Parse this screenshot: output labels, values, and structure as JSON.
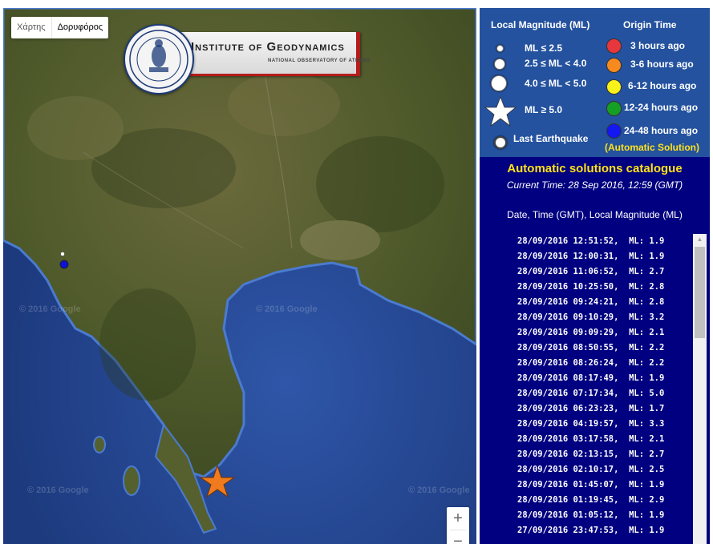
{
  "map": {
    "map_type_buttons": [
      {
        "label": "Χάρτης",
        "active": false
      },
      {
        "label": "Δορυφόρος",
        "active": true
      }
    ],
    "logo": {
      "title": "Institute of Geodynamics",
      "subtitle": "NATIONAL OBSERVATORY OF ATHENS"
    },
    "watermarks": [
      "© 2016 Google",
      "© 2016 Google",
      "© 2016 Google",
      "© 2016 Google"
    ],
    "zoom_in": "+",
    "zoom_out": "−",
    "markers": [
      {
        "type": "last-earthquake",
        "shape": "star",
        "color": "#f07a1e",
        "magnitude": "ML: 5.0",
        "time": "28/09/2016 07:17:34"
      },
      {
        "type": "earthquake",
        "shape": "circle",
        "color": "#0b12d6",
        "age": "24-48 hours ago"
      },
      {
        "type": "earthquake",
        "shape": "circle",
        "color": "#ffffff",
        "age": "small"
      }
    ],
    "colors": {
      "sea": "#1f3f86",
      "deep_sea": "#2a4fa0",
      "land": "#55602f",
      "coast": "#3e6ec0"
    }
  },
  "legend": {
    "magnitude_header": "Local Magnitude (ML)",
    "origin_header": "Origin Time",
    "magnitude_items": [
      {
        "label": "ML ≤ 2.5",
        "icon": "small-circle-icon"
      },
      {
        "label": "2.5 ≤ ML < 4.0",
        "icon": "medium-circle-icon"
      },
      {
        "label": "4.0 ≤ ML < 5.0",
        "icon": "large-circle-icon"
      },
      {
        "label": "ML ≥ 5.0",
        "icon": "star-icon"
      },
      {
        "label": "Last Earthquake",
        "icon": "ring-icon"
      }
    ],
    "origin_items": [
      {
        "label": "3 hours ago",
        "color": "#e8373c"
      },
      {
        "label": "3-6 hours ago",
        "color": "#f68a1f"
      },
      {
        "label": "6-12 hours ago",
        "color": "#f9f21a"
      },
      {
        "label": "12-24 hours ago",
        "color": "#159f24"
      },
      {
        "label": "24-48 hours ago",
        "color": "#1318f0"
      }
    ],
    "automatic_note": "(Automatic Solution)"
  },
  "catalog": {
    "title": "Automatic solutions catalogue",
    "current_time": "Current Time: 28 Sep 2016, 12:59 (GMT)",
    "columns": "Date, Time (GMT), Local Magnitude (ML)",
    "entries": [
      "28/09/2016 12:51:52,  ML: 1.9",
      "28/09/2016 12:00:31,  ML: 1.9",
      "28/09/2016 11:06:52,  ML: 2.7",
      "28/09/2016 10:25:50,  ML: 2.8",
      "28/09/2016 09:24:21,  ML: 2.8",
      "28/09/2016 09:10:29,  ML: 3.2",
      "28/09/2016 09:09:29,  ML: 2.1",
      "28/09/2016 08:50:55,  ML: 2.2",
      "28/09/2016 08:26:24,  ML: 2.2",
      "28/09/2016 08:17:49,  ML: 1.9",
      "28/09/2016 07:17:34,  ML: 5.0",
      "28/09/2016 06:23:23,  ML: 1.7",
      "28/09/2016 04:19:57,  ML: 3.3",
      "28/09/2016 03:17:58,  ML: 2.1",
      "28/09/2016 02:13:15,  ML: 2.7",
      "28/09/2016 02:10:17,  ML: 2.5",
      "28/09/2016 01:45:07,  ML: 1.9",
      "28/09/2016 01:19:45,  ML: 2.9",
      "28/09/2016 01:05:12,  ML: 1.9",
      "27/09/2016 23:47:53,  ML: 1.9"
    ],
    "scroll_up": "▲"
  }
}
